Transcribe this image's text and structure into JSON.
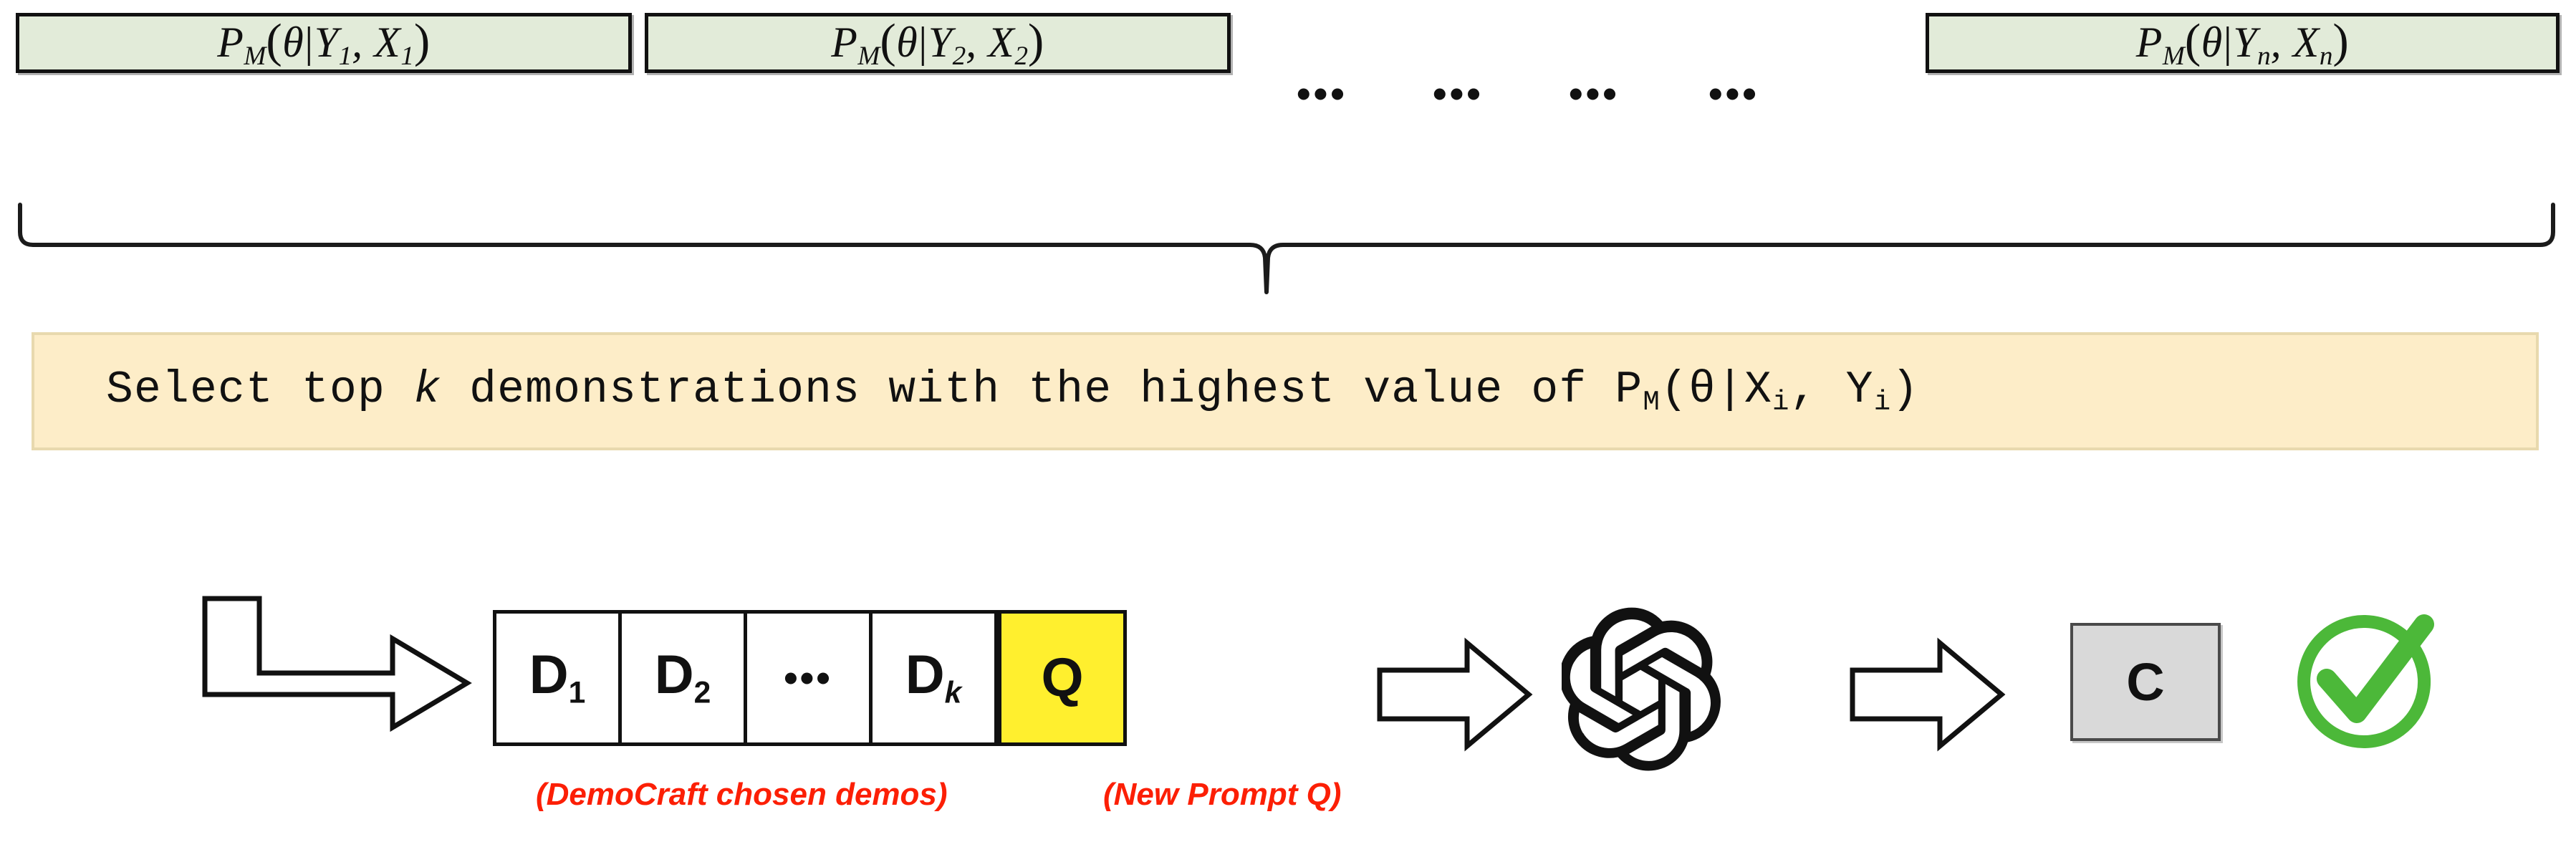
{
  "posterior_row": {
    "boxes": [
      {
        "name": "posterior-1",
        "prefix": "P",
        "model_sub": "M",
        "theta": "θ",
        "first_var": "Y",
        "first_sub": "1",
        "second_var": "X",
        "second_sub": "1",
        "text": "P_M(θ|Y_1, X_1)"
      },
      {
        "name": "posterior-2",
        "prefix": "P",
        "model_sub": "M",
        "theta": "θ",
        "first_var": "Y",
        "first_sub": "2",
        "second_var": "X",
        "second_sub": "2",
        "text": "P_M(θ|Y_2, X_2)"
      },
      {
        "name": "posterior-n",
        "prefix": "P",
        "model_sub": "M",
        "theta": "θ",
        "first_var": "Y",
        "first_sub": "n",
        "second_var": "X",
        "second_sub": "n",
        "text": "P_M(θ|Y_n, X_n)"
      }
    ],
    "ellipsis": [
      "•••",
      "•••",
      "•••",
      "•••"
    ]
  },
  "instruction": {
    "full_text": "Select top k demonstrations with the highest value of P_M(θ|X_i, Y_i)",
    "part_a": "Select top ",
    "k": "k",
    "part_b": " demonstrations with the highest value of P",
    "model_sub": "M",
    "part_c": "(θ|X",
    "i_sub_1": "i",
    "part_d": ", Y",
    "i_sub_2": "i",
    "part_e": ")"
  },
  "pipeline": {
    "demo_cells": [
      {
        "name": "demo-1",
        "label": "D",
        "sub": "1",
        "sub_italic": false,
        "highlight": false
      },
      {
        "name": "demo-2",
        "label": "D",
        "sub": "2",
        "sub_italic": false,
        "highlight": false
      },
      {
        "name": "demo-ellipsis",
        "label": "•••",
        "sub": "",
        "sub_italic": false,
        "highlight": false
      },
      {
        "name": "demo-k",
        "label": "D",
        "sub": "k",
        "sub_italic": true,
        "highlight": false
      },
      {
        "name": "query",
        "label": "Q",
        "sub": "",
        "sub_italic": false,
        "highlight": true
      }
    ],
    "completion_label": "C",
    "captions": {
      "demos": "(DemoCraft chosen demos)",
      "prompt": "(New Prompt Q)"
    },
    "icons": {
      "openai": "openai-logo-icon",
      "check": "green-check-circle-icon",
      "elbow_arrow": "elbow-arrow-icon",
      "block_arrow_1": "block-arrow-icon",
      "block_arrow_2": "block-arrow-icon"
    }
  },
  "colors": {
    "posterior_fill": "#e2ebd9",
    "banner_fill": "#fdedc8",
    "query_highlight": "#ffef2e",
    "completion_fill": "#d9d9d9",
    "caption_red": "#fc1f05",
    "check_green": "#4cb839",
    "stroke": "#111111"
  }
}
